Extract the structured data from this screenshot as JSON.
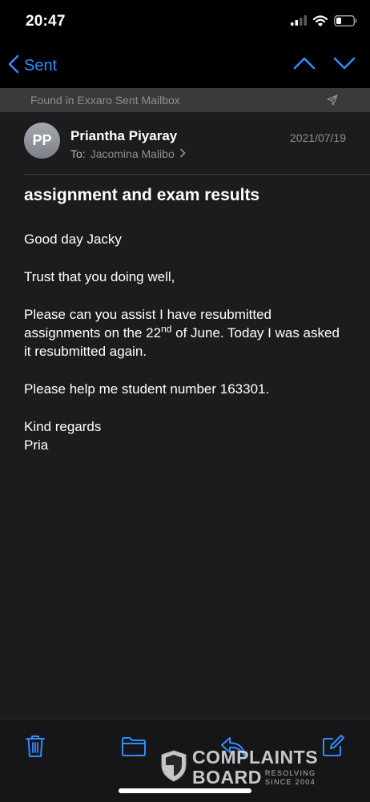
{
  "status_bar": {
    "time": "20:47",
    "icons": [
      "cellular-signal-icon",
      "wifi-icon",
      "battery-icon"
    ]
  },
  "nav": {
    "back_label": "Sent",
    "icons": [
      "chevron-left-icon",
      "chevron-up-icon",
      "chevron-down-icon"
    ]
  },
  "mailbox": {
    "label": "Found in Exxaro Sent Mailbox",
    "icon": "send-icon"
  },
  "email": {
    "avatar_initials": "PP",
    "sender": "Priantha Piyaray",
    "to_label": "To:",
    "recipient": "Jacomina Malibo",
    "date": "2021/07/19",
    "subject": "assignment and exam results",
    "greeting": "Good day Jacky",
    "line_trust": "Trust that you doing well,",
    "para_assist_start": "Please can you assist I have resubmitted assignments on the 22",
    "para_assist_sup": "nd",
    "para_assist_end": " of June. Today I was asked it resubmitted again.",
    "line_help": "Please help me student number 163301.",
    "closing": "Kind regards",
    "signature": "Pria"
  },
  "toolbar": {
    "icons": [
      "trash-icon",
      "folder-icon",
      "reply-icon",
      "compose-icon"
    ]
  },
  "watermark": {
    "line1": "COMPLAINTS",
    "line2": "BOARD",
    "tagline1": "RESOLVING",
    "tagline2": "SINCE 2004"
  },
  "colors": {
    "accent": "#2f8cff",
    "background": "#1c1c1e",
    "bar_background": "#000000",
    "secondary_text": "#8e8e93"
  }
}
